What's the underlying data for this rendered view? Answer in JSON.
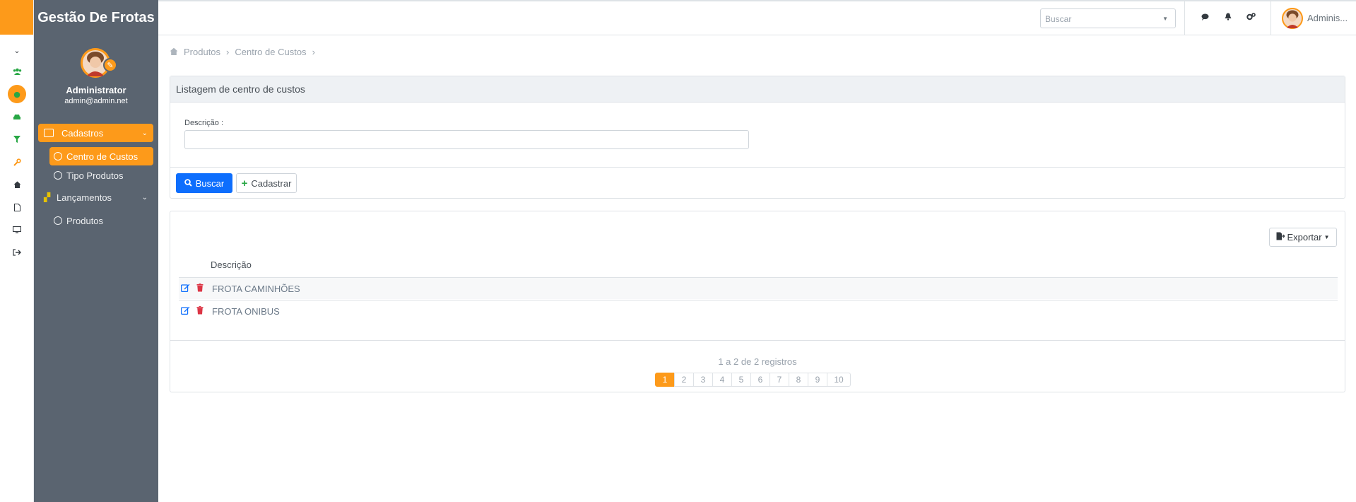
{
  "app": {
    "brand": "Gestão De Frotas"
  },
  "colors": {
    "accent": "#fd9a1a",
    "sidebar_bg": "#5a6470",
    "primary": "#0d6efd",
    "danger": "#dc3545",
    "success": "#28a745"
  },
  "profile": {
    "name": "Administrator",
    "email": "admin@admin.net"
  },
  "sidebar": {
    "cadastros": {
      "label": "Cadastros",
      "items": [
        {
          "label": "Centro de Custos",
          "active": true
        },
        {
          "label": "Tipo Produtos",
          "active": false
        }
      ]
    },
    "lancamentos": {
      "label": "Lançamentos",
      "items": [
        {
          "label": "Produtos",
          "active": false
        }
      ]
    }
  },
  "rail_icons": [
    "chevron-down-icon",
    "users-icon",
    "circle-icon",
    "car-icon",
    "filter-icon",
    "wrench-icon",
    "home-icon",
    "file-icon",
    "monitor-icon",
    "logout-icon"
  ],
  "header": {
    "search_placeholder": "Buscar",
    "icons": [
      "chat-icon",
      "bell-icon",
      "gears-icon"
    ],
    "user": "Adminis..."
  },
  "breadcrumb": [
    "Produtos",
    "Centro de Custos"
  ],
  "filter_card": {
    "title": "Listagem de centro de custos",
    "desc_label": "Descrição :",
    "desc_value": "",
    "search_button": "Buscar",
    "create_button": "Cadastrar"
  },
  "list_card": {
    "export_button": "Exportar",
    "column": "Descrição",
    "rows": [
      "FROTA CAMINHÕES",
      "FROTA ONIBUS"
    ],
    "count_text": "1 a 2 de 2 registros",
    "pages": [
      "1",
      "2",
      "3",
      "4",
      "5",
      "6",
      "7",
      "8",
      "9",
      "10"
    ],
    "current_page": "1"
  }
}
